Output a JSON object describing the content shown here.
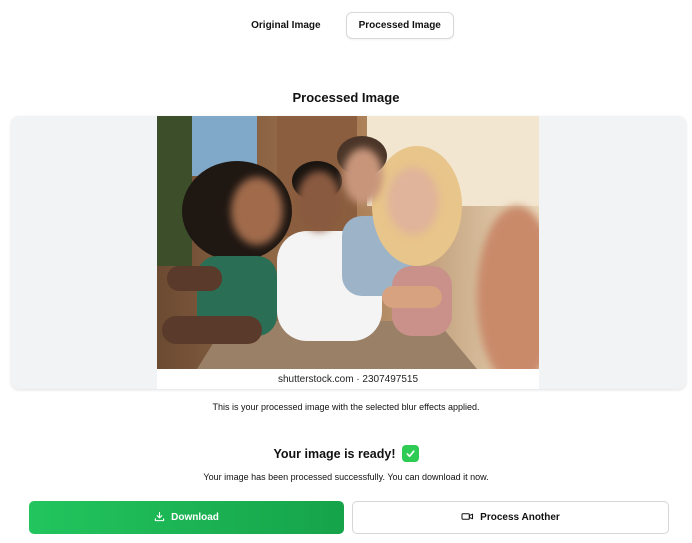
{
  "tabs": [
    {
      "label": "Original Image",
      "active": false
    },
    {
      "label": "Processed Image",
      "active": true
    }
  ],
  "preview": {
    "title": "Processed Image",
    "watermark": "shutterstock.com · 2307497515",
    "caption": "This is your processed image with the selected blur effects applied."
  },
  "result": {
    "title": "Your image is ready!",
    "subtitle": "Your image has been processed successfully. You can download it now."
  },
  "actions": {
    "download_label": "Download",
    "process_another_label": "Process Another"
  },
  "colors": {
    "accent_green": "#22c55e",
    "card_bg": "#f2f3f5"
  }
}
